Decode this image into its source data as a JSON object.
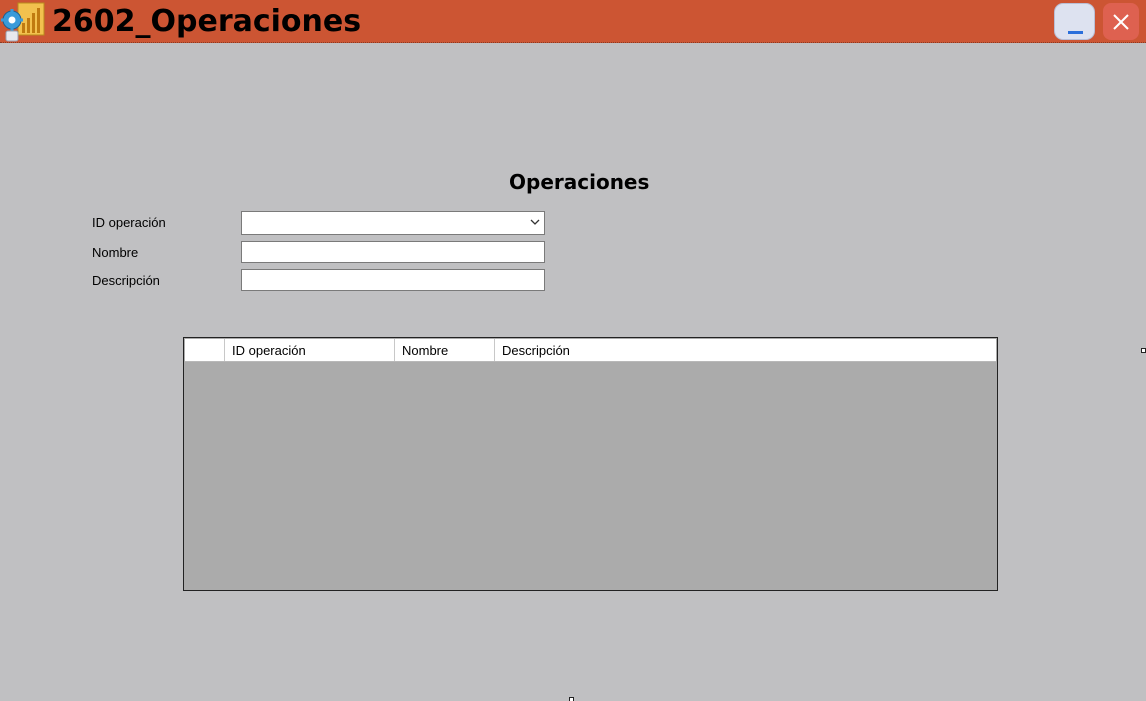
{
  "window": {
    "title": "2602_Operaciones",
    "icon": "app-gear-chart-icon",
    "minimize_icon": "minimize-icon",
    "close_icon": "close-icon",
    "colors": {
      "titlebar": "#cc5533",
      "background": "#c0c0c2",
      "grid_background": "#ababab",
      "close_button": "#de6150",
      "minimize_button": "#dde2f0"
    }
  },
  "form": {
    "title": "Operaciones",
    "id_label": "ID operación",
    "id_value": "",
    "nombre_label": "Nombre",
    "nombre_value": "",
    "descripcion_label": "Descripción",
    "descripcion_value": ""
  },
  "grid": {
    "columns": [
      "ID operación",
      "Nombre",
      "Descripción"
    ],
    "rows": []
  }
}
